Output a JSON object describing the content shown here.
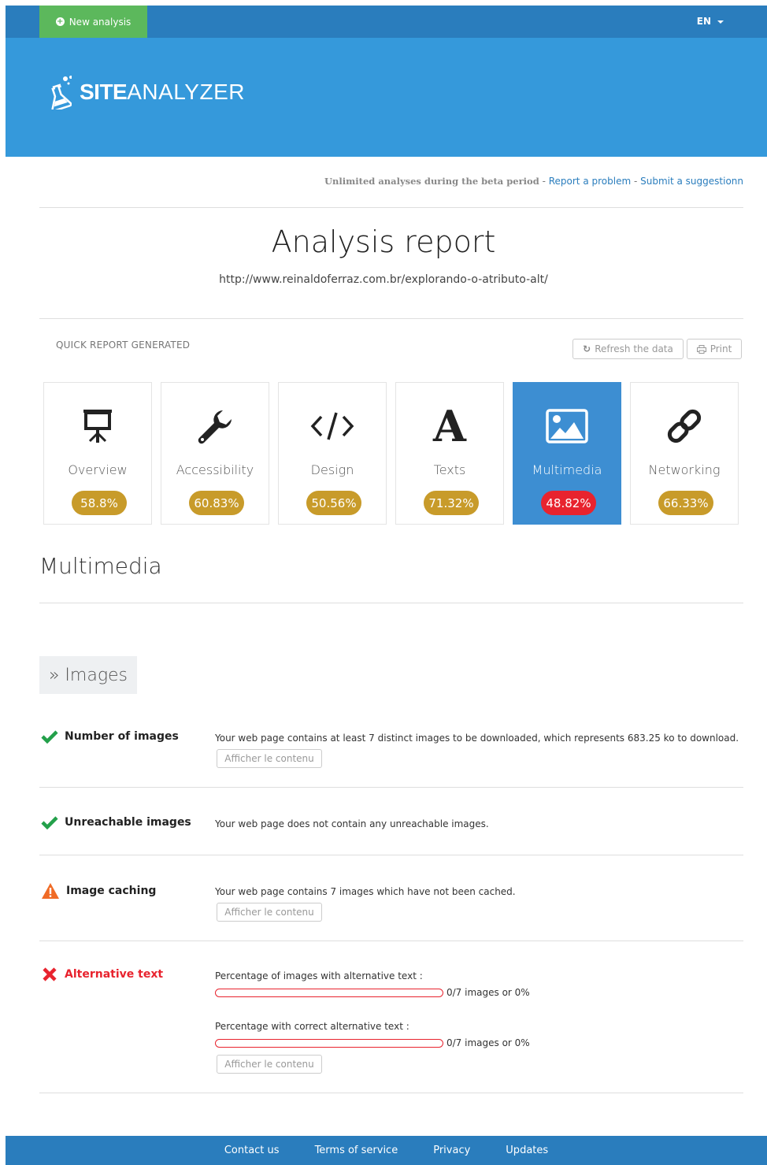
{
  "header": {
    "new_analysis": "New analysis",
    "language": "EN",
    "logo_bold": "SITE",
    "logo_light": "ANALYZER"
  },
  "notice": {
    "beta": "Unlimited analyses during the beta period",
    "sep1": " - ",
    "report_problem": "Report a problem",
    "sep2": " - ",
    "suggestion": "Submit a suggestionn"
  },
  "report": {
    "title": "Analysis report",
    "url": "http://www.reinaldoferraz.com.br/explorando-o-atributo-alt/",
    "quick_label": "QUICK REPORT GENERATED",
    "refresh_label": "Refresh the data",
    "print_label": "Print"
  },
  "categories": [
    {
      "label": "Overview",
      "score": "58.8%",
      "icon": "presentation-icon"
    },
    {
      "label": "Accessibility",
      "score": "60.83%",
      "icon": "wrench-icon"
    },
    {
      "label": "Design",
      "score": "50.56%",
      "icon": "code-icon"
    },
    {
      "label": "Texts",
      "score": "71.32%",
      "icon": "font-icon"
    },
    {
      "label": "Multimedia",
      "score": "48.82%",
      "icon": "image-icon"
    },
    {
      "label": "Networking",
      "score": "66.33%",
      "icon": "link-icon"
    }
  ],
  "section": {
    "title": "Multimedia",
    "subsection": "» Images"
  },
  "checks": {
    "num_images": {
      "title": "Number of images",
      "status": "ok",
      "text": "Your web page contains at least 7 distinct images to be downloaded, which represents 683.25 ko to download.",
      "button": "Afficher le contenu"
    },
    "unreachable": {
      "title": "Unreachable images",
      "status": "ok",
      "text": "Your web page does not contain any unreachable images."
    },
    "caching": {
      "title": "Image caching",
      "status": "warning",
      "text": "Your web page contains 7 images which have not been cached.",
      "button": "Afficher le contenu"
    },
    "alt_text": {
      "title": "Alternative text",
      "status": "error",
      "label1": "Percentage of images with alternative text :",
      "value1": "0/7 images or 0%",
      "fill1": 0,
      "label2": "Percentage with correct alternative text :",
      "value2": "0/7 images or 0%",
      "fill2": 0,
      "button": "Afficher le contenu"
    }
  },
  "footer": {
    "contact": "Contact us",
    "terms": "Terms of service",
    "privacy": "Privacy",
    "updates": "Updates"
  },
  "colors": {
    "header_blue": "#2a7dbd",
    "banner_blue": "#3599db",
    "green": "#5cb85c",
    "score_gold": "#c89b2a",
    "error_red": "#e8232e",
    "active_card": "#3d8ed2"
  }
}
